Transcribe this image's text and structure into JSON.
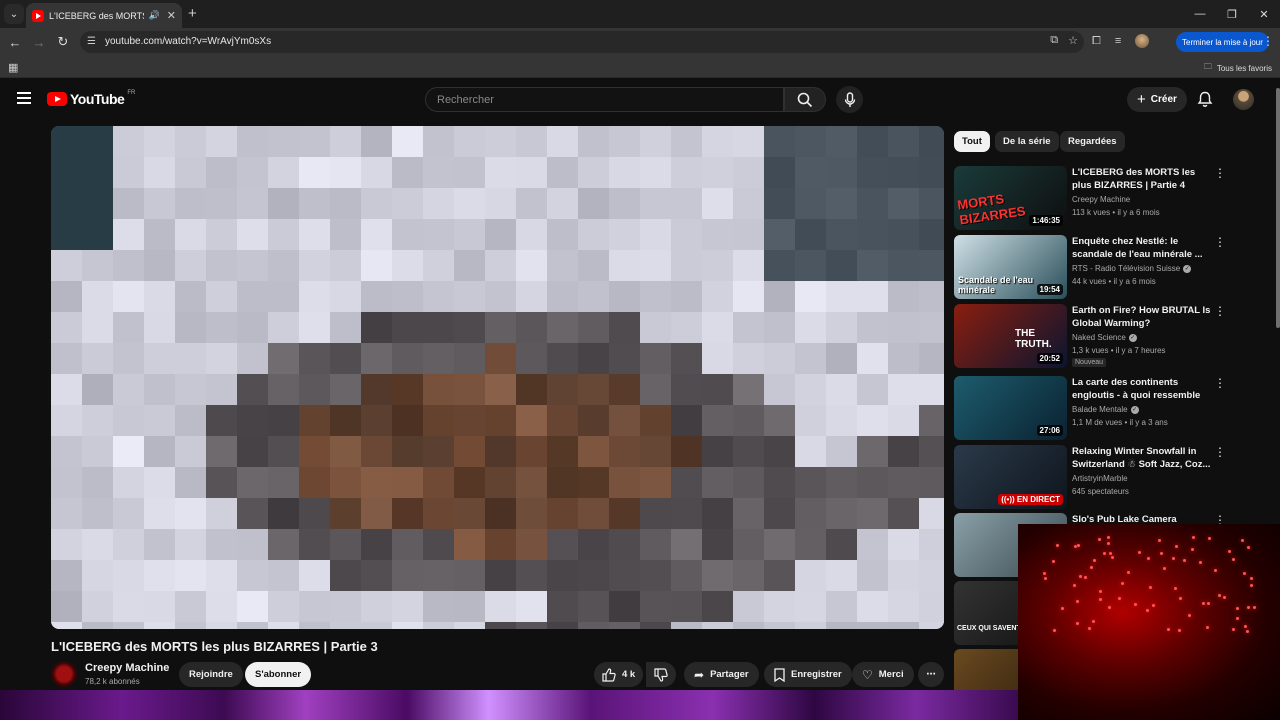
{
  "browser": {
    "tab_title": "L'ICEBERG des MORTS les p",
    "url": "youtube.com/watch?v=WrAvjYm0sXs",
    "update_label": "Terminer la mise à jour",
    "bookmarks_label": "Tous les favoris"
  },
  "header": {
    "logo_text": "YouTube",
    "region": "FR",
    "search_placeholder": "Rechercher",
    "create_label": "Créer"
  },
  "video": {
    "title": "L'ICEBERG des MORTS les plus BIZARRES | Partie 3",
    "channel": "Creepy Machine",
    "subscribers": "78,2 k abonnés",
    "join_label": "Rejoindre",
    "subscribe_label": "S'abonner",
    "likes": "4 k",
    "share_label": "Partager",
    "save_label": "Enregistrer",
    "thanks_label": "Merci"
  },
  "chips": [
    "Tout",
    "De la série",
    "Regardées"
  ],
  "recommendations": [
    {
      "title": "L'ICEBERG des MORTS les plus BIZARRES | Partie 4",
      "channel": "Creepy Machine",
      "verified": false,
      "views": "113 k vues",
      "age": "il y a 6 mois",
      "duration": "1:46:35",
      "thumb_text": "MORTS BIZARRES",
      "thumb_colors": [
        "#1a3b3a",
        "#0e0e0e"
      ]
    },
    {
      "title": "Enquête chez Nestlé: le scandale de l'eau minérale ...",
      "channel": "RTS - Radio Télévision Suisse",
      "verified": true,
      "views": "44 k vues",
      "age": "il y a 6 mois",
      "duration": "19:54",
      "thumb_text": "Scandale de l'eau minérale",
      "thumb_colors": [
        "#cfe0e6",
        "#2a4f5a"
      ]
    },
    {
      "title": "Earth on Fire? How BRUTAL Is Global Warming?",
      "channel": "Naked Science",
      "verified": true,
      "views": "1,3 k vues",
      "age": "il y a 7 heures",
      "duration": "20:52",
      "badge": "Nouveau",
      "thumb_text": "THE TRUTH.",
      "thumb_colors": [
        "#8a1e0e",
        "#0a1530"
      ]
    },
    {
      "title": "La carte des continents engloutis - à quoi ressemble la...",
      "channel": "Balade Mentale",
      "verified": true,
      "views": "1,1 M de vues",
      "age": "il y a 3 ans",
      "duration": "27:06",
      "thumb_text": "",
      "thumb_colors": [
        "#1d5c6e",
        "#0a2230"
      ]
    },
    {
      "title": "Relaxing Winter Snowfall in Switzerland ☃ Soft Jazz, Coz...",
      "channel": "ArtistryinMarble",
      "verified": false,
      "views": "645 spectateurs",
      "age": "",
      "live_label": "EN DIRECT",
      "thumb_text": "",
      "thumb_colors": [
        "#2a3a4a",
        "#0e141c"
      ]
    },
    {
      "title": "Slo's Pub Lake Camera",
      "channel": "",
      "verified": false,
      "views": "",
      "age": "",
      "thumb_text": "",
      "thumb_colors": [
        "#8aa0a8",
        "#3a4a50"
      ]
    },
    {
      "title": "",
      "channel": "",
      "verified": false,
      "views": "",
      "age": "",
      "thumb_text": "CEUX QUI SAVENT",
      "thumb_colors": [
        "#333",
        "#111"
      ]
    },
    {
      "title": "",
      "channel": "",
      "verified": false,
      "views": "",
      "age": "",
      "thumb_text": "",
      "thumb_colors": [
        "#6a4a20",
        "#2a1a0a"
      ]
    }
  ]
}
